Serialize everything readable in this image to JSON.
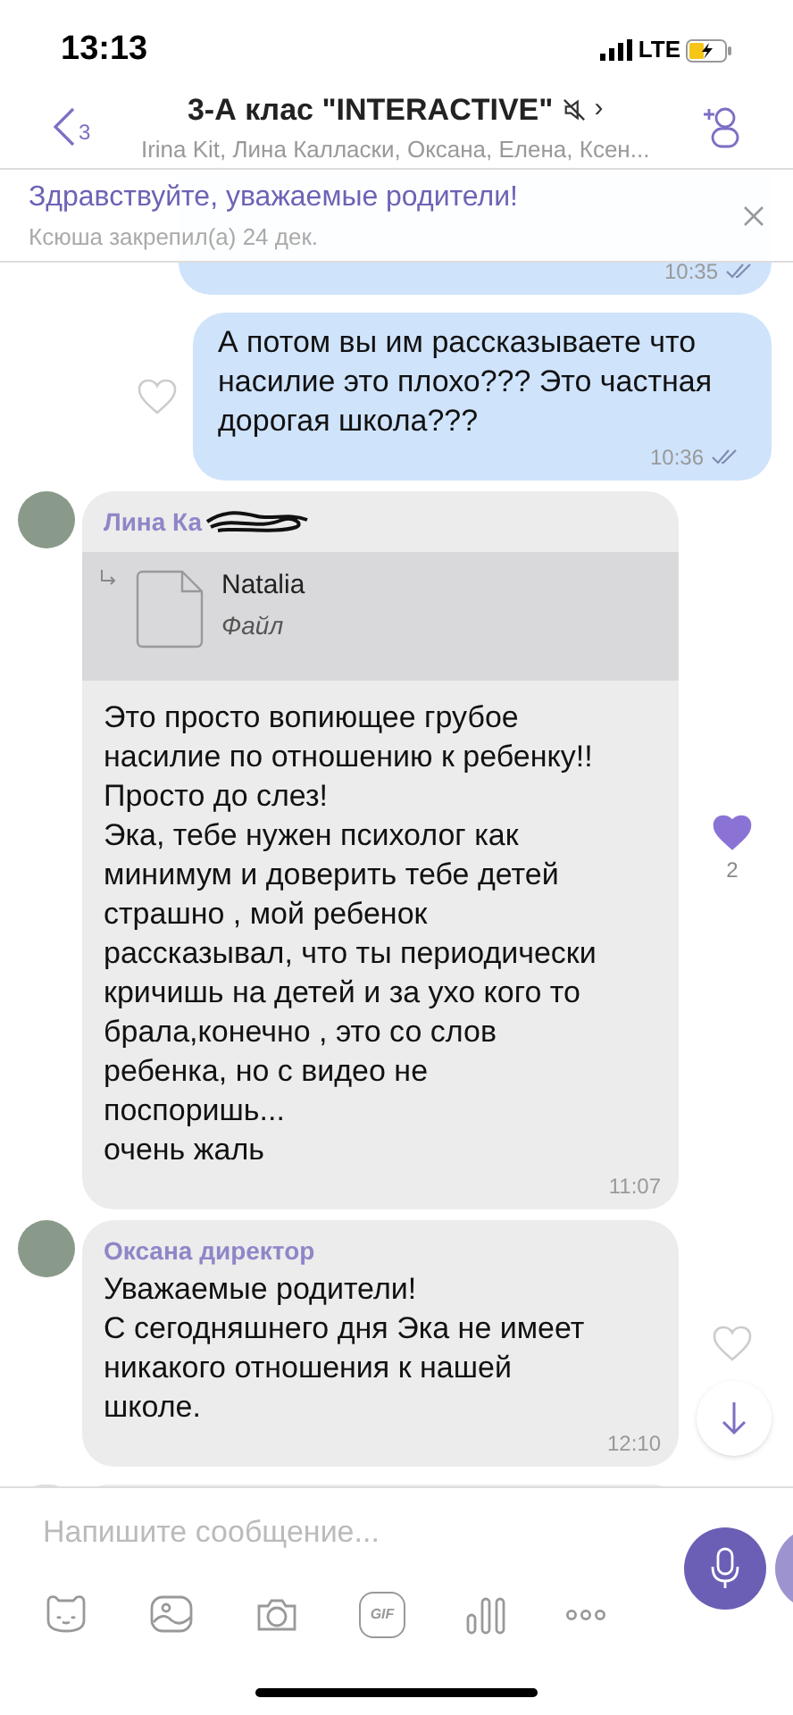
{
  "status_bar": {
    "time": "13:13",
    "network": "LTE"
  },
  "header": {
    "back_count": "3",
    "title": "3-А клас \"INTERACTIVE\"",
    "chevron": "›",
    "members": "Irina Kit, Лина Калласки, Оксана, Елена, Ксен..."
  },
  "pinned": {
    "text": "Здравствуйте, уважаемые родители!",
    "meta": "Ксюша закрепил(а) 24 дек."
  },
  "messages": [
    {
      "kind": "outgoing",
      "time": "10:35"
    },
    {
      "kind": "outgoing",
      "text": "А потом вы им рассказываете что насилие это плохо??? Это частная дорогая школа???",
      "time": "10:36",
      "liked": false
    },
    {
      "kind": "incoming",
      "sender": "Лина Ка",
      "sender_scribbled": true,
      "forward": {
        "file_name": "Natalia",
        "file_type": "Файл"
      },
      "text": "Это просто вопиющее грубое насилие по отношению к ребенку!! Просто до слез!\nЭка, тебе нужен психолог как минимум и доверить тебе детей страшно , мой ребенок рассказывал, что ты периодически кричишь на детей и за ухо кого то брала,конечно , это со слов ребенка, но с видео не поспоришь...\nочень жаль",
      "time": "11:07",
      "liked": true,
      "likes": "2"
    },
    {
      "kind": "incoming",
      "sender": "Оксана директор",
      "text": "Уважаемые родители!\nС сегодняшнего дня Эка не имеет никакого отношения к нашей школе.",
      "time": "12:10",
      "liked": false
    }
  ],
  "composer": {
    "placeholder": "Напишите сообщение...",
    "gif_label": "GIF"
  }
}
